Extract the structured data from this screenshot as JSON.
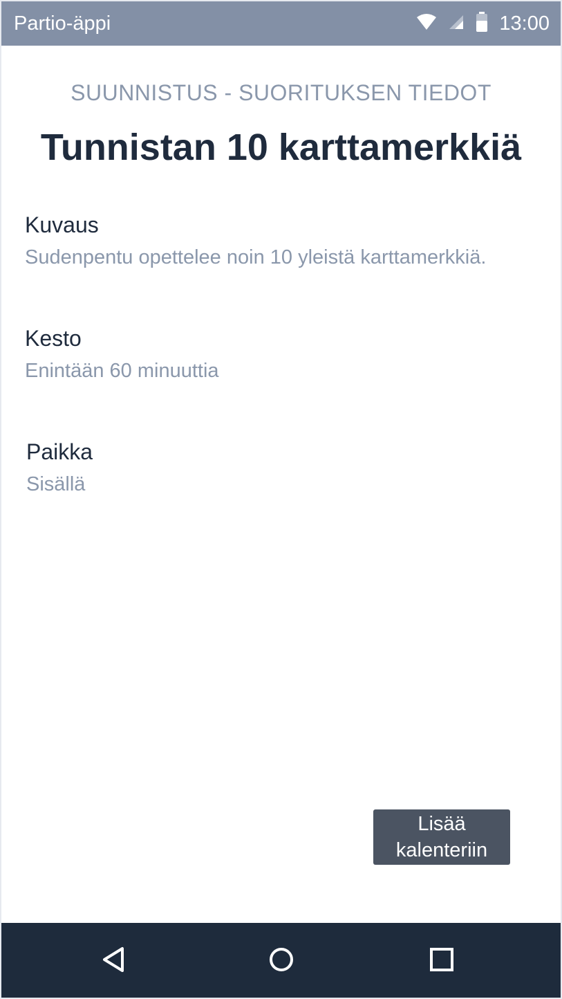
{
  "status_bar": {
    "app_name": "Partio-äppi",
    "time": "13:00",
    "icons": [
      "wifi-icon",
      "cell-signal-icon",
      "battery-icon"
    ]
  },
  "page": {
    "section_title": "SUUNNISTUS - SUORITUKSEN TIEDOT",
    "title": "Tunnistan 10 karttamerkkiä"
  },
  "fields": {
    "description": {
      "label": "Kuvaus",
      "value": "Sudenpentu opettelee noin 10 yleistä karttamerkkiä."
    },
    "duration": {
      "label": "Kesto",
      "value": "Enintään 60 minuuttia"
    },
    "location": {
      "label": "Paikka",
      "value": "Sisällä"
    }
  },
  "actions": {
    "add_to_calendar_line1": "Lisää",
    "add_to_calendar_line2": "kalenteriin"
  },
  "nav": {
    "icons": [
      "back-icon",
      "home-icon",
      "recents-icon"
    ]
  },
  "colors": {
    "status_bar": "#8390a6",
    "title_text": "#1f2b3d",
    "muted_text": "#8a97ab",
    "button_bg": "#4b5462",
    "nav_bar": "#1e2b3c"
  }
}
